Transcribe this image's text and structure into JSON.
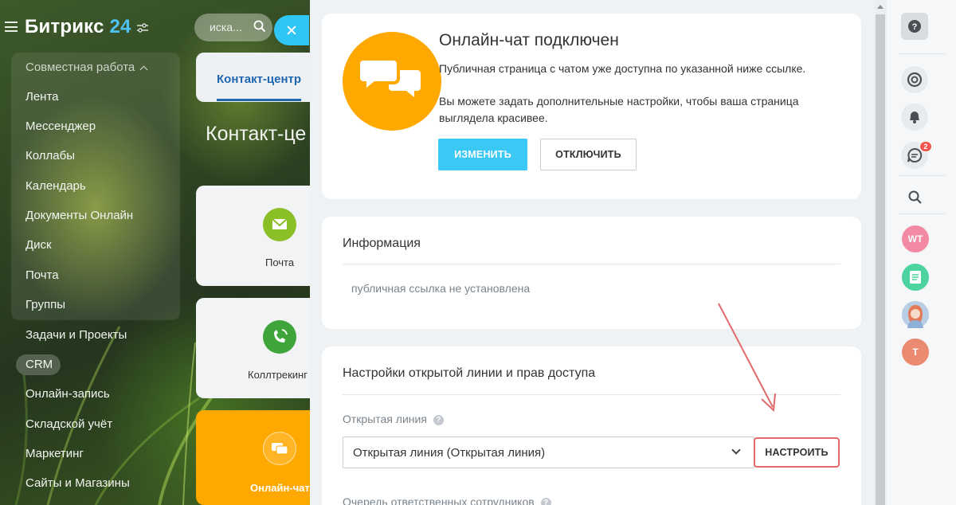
{
  "brand": {
    "name": "Битрикс",
    "number": "24"
  },
  "sidebar": {
    "group_title": "Совместная работа",
    "group_items": [
      "Лента",
      "Мессенджер",
      "Коллабы",
      "Календарь",
      "Документы Онлайн",
      "Диск",
      "Почта",
      "Группы"
    ],
    "items": [
      "Задачи и Проекты",
      "CRM",
      "Онлайн-запись",
      "Складской учёт",
      "Маркетинг",
      "Сайты и Магазины"
    ],
    "active_item": "CRM"
  },
  "background_page": {
    "search_placeholder": "иска...",
    "tab_label": "Контакт-центр",
    "page_title": "Контакт-це",
    "tiles": [
      {
        "label": "Почта",
        "icon": "mail-icon",
        "color": "#8bbf26"
      },
      {
        "label": "Коллтрекинг",
        "icon": "phone-icon",
        "color": "#3fa53b"
      },
      {
        "label": "Онлайн-чат",
        "icon": "chat-icon",
        "color": "#ffa900"
      }
    ]
  },
  "slider": {
    "header": {
      "title": "Онлайн-чат подключен",
      "text_1": "Публичная страница с чатом уже доступна по указанной ниже ссылке.",
      "text_2": "Вы можете задать дополнительные настройки, чтобы ваша страница",
      "text_3": "выглядела красивее.",
      "btn_change": "ИЗМЕНИТЬ",
      "btn_disable": "ОТКЛЮЧИТЬ"
    },
    "info": {
      "title": "Информация",
      "link_status": "публичная ссылка не установлена"
    },
    "settings": {
      "title": "Настройки открытой линии и прав доступа",
      "open_line_label": "Открытая линия",
      "open_line_value": "Открытая линия (Открытая линия)",
      "btn_configure": "НАСТРОИТЬ",
      "queue_label": "Очередь ответственных сотрудников"
    }
  },
  "rail": {
    "chat_badge": "2",
    "avatars": [
      {
        "initials": "WT",
        "color": "#f28aa3"
      },
      {
        "initials": "",
        "color": "#4cd3a0"
      },
      {
        "initials": "",
        "color": "#9fb6d6"
      },
      {
        "initials": "T",
        "color": "#ea8a70"
      }
    ]
  },
  "colors": {
    "accent": "#3bc8f5",
    "highlight": "#e26a6a",
    "chat_logo": "#ffa900"
  }
}
